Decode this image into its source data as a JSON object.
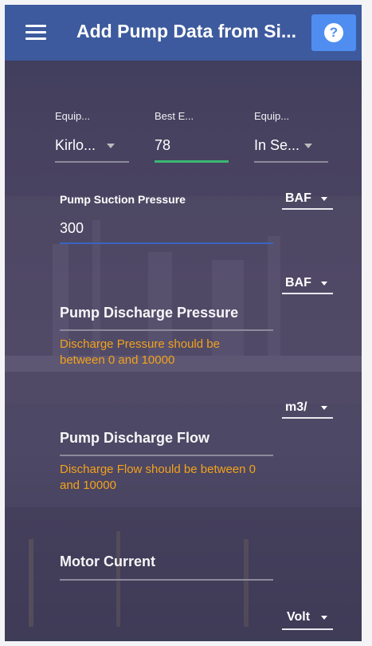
{
  "header": {
    "title": "Add Pump Data from Si...",
    "menu_icon": "hamburger-icon",
    "help_icon": "help-icon",
    "help_glyph": "?",
    "color": "#3d5a9e"
  },
  "top_fields": [
    {
      "label": "Equip...",
      "value": "Kirlo..."
    },
    {
      "label": "Best E...",
      "value": "78"
    },
    {
      "label": "Equip...",
      "value": "In Se..."
    }
  ],
  "suction": {
    "label": "Pump Suction Pressure",
    "value": "300",
    "unit": "BAF"
  },
  "discharge_pressure": {
    "label": "Pump Discharge Pressure",
    "unit": "BAF",
    "error": "Discharge Pressure should be between 0 and 10000"
  },
  "discharge_flow": {
    "label": "Pump Discharge Flow",
    "unit": "m3/",
    "error": "Discharge Flow should be between 0 and 10000"
  },
  "motor_current": {
    "label": "Motor Current"
  },
  "volt_unit": "Volt",
  "colors": {
    "error": "#f3a21c",
    "active_line": "#39b873",
    "focus_line": "#3b64c0",
    "help_button": "#4f8ef0"
  }
}
